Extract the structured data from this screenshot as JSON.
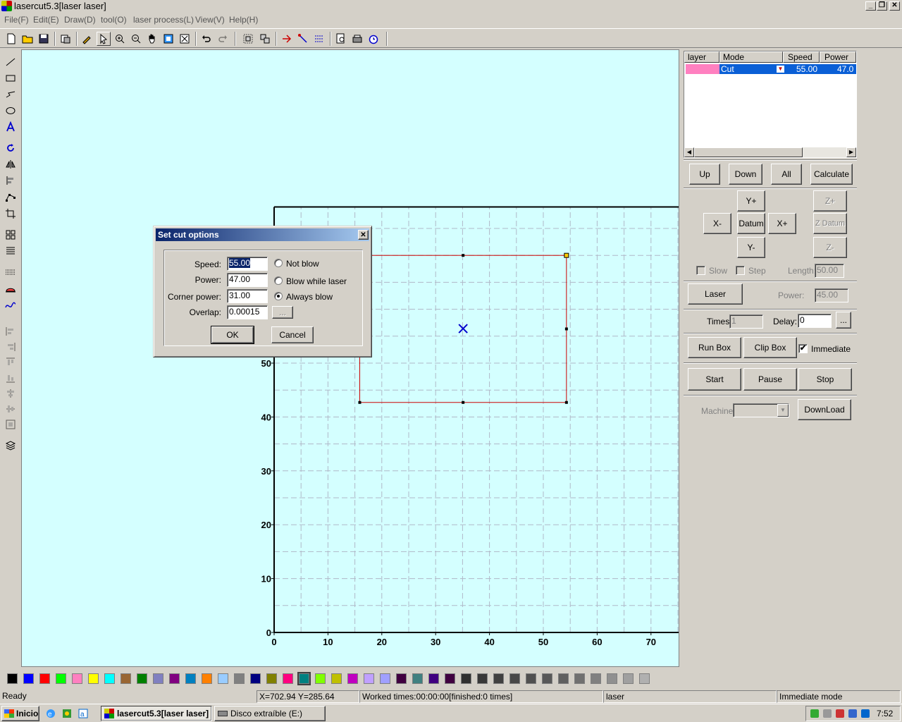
{
  "window": {
    "title": "lasercut5.3[laser laser]"
  },
  "menu": [
    "File(F)",
    "Edit(E)",
    "Draw(D)",
    "tool(O)",
    "laser process(L)",
    "View(V)",
    "Help(H)"
  ],
  "layers": {
    "headers": [
      "layer",
      "Mode",
      "Speed",
      "Power"
    ],
    "rows": [
      {
        "color": "#ff80c0",
        "mode": "Cut",
        "speed": "55.00",
        "power": "47.0"
      }
    ]
  },
  "panel": {
    "up": "Up",
    "down": "Down",
    "all": "All",
    "calculate": "Calculate",
    "y_plus": "Y+",
    "y_minus": "Y-",
    "x_minus": "X-",
    "x_plus": "X+",
    "datum": "Datum",
    "z_plus": "Z+",
    "z_datum": "Z Datum",
    "z_minus": "Z-",
    "slow": "Slow",
    "step": "Step",
    "length_label": "Length:",
    "length_value": "50.00",
    "laser": "Laser",
    "power_label": "Power:",
    "power_value": "45.00",
    "times_label": "Times:",
    "times_value": "1",
    "delay_label": "Delay:",
    "delay_value": "0",
    "ellipsis": "...",
    "run_box": "Run Box",
    "clip_box": "Clip Box",
    "immediate": "Immediate",
    "start": "Start",
    "pause": "Pause",
    "stop": "Stop",
    "machine_label": "Machine:",
    "download": "DownLoad"
  },
  "chart_data": {
    "type": "scatter",
    "title": "",
    "x_ticks": [
      "0",
      "10",
      "20",
      "30",
      "40",
      "50",
      "60",
      "70"
    ],
    "y_ticks": [
      "0",
      "10",
      "20",
      "30",
      "40",
      "50"
    ],
    "xlim": [
      0,
      75
    ],
    "ylim": [
      0,
      79
    ],
    "grid": true,
    "selection_rect": {
      "x": [
        15.9,
        54.3
      ],
      "y": [
        42.7,
        70.0
      ]
    },
    "center_mark": [
      35.1,
      56.4
    ]
  },
  "dialog": {
    "title": "Set cut options",
    "speed_label": "Speed:",
    "speed_value": "55.00",
    "power_label": "Power:",
    "power_value": "47.00",
    "corner_label": "Corner power:",
    "corner_value": "31.00",
    "overlap_label": "Overlap:",
    "overlap_value": "0.00015",
    "ellipsis": "...",
    "not_blow": "Not blow",
    "blow_while_laser": "Blow while laser",
    "always_blow": "Always blow",
    "ok": "OK",
    "cancel": "Cancel"
  },
  "palette": [
    "#000000",
    "#0000ff",
    "#ff0000",
    "#00ff00",
    "#ff80c0",
    "#ffff00",
    "#00ffff",
    "#996633",
    "#008000",
    "#8080c0",
    "#800080",
    "#0080c0",
    "#ff8000",
    "#99ccff",
    "#808080",
    "#000080",
    "#808000",
    "#ff0080",
    "#008080",
    "#80ff00",
    "#c0c000",
    "#c000c0",
    "#c0a0ff",
    "#a0a0ff",
    "#400040",
    "#408080",
    "#400080",
    "#400040",
    "#303030",
    "#383838",
    "#404040",
    "#484848",
    "#505050",
    "#585858",
    "#606060",
    "#707070",
    "#808080",
    "#909090",
    "#a0a0a0",
    "#b0b0b0"
  ],
  "status": {
    "ready": "Ready",
    "coords": "X=702.94 Y=285.64",
    "worked": "Worked times:00:00:00[finished:0 times]",
    "device": "laser",
    "mode": "Immediate mode"
  },
  "taskbar": {
    "start": "Inicio",
    "task1": "lasercut5.3[laser laser]",
    "task2": "Disco extraíble (E:)",
    "clock": "7:52"
  }
}
